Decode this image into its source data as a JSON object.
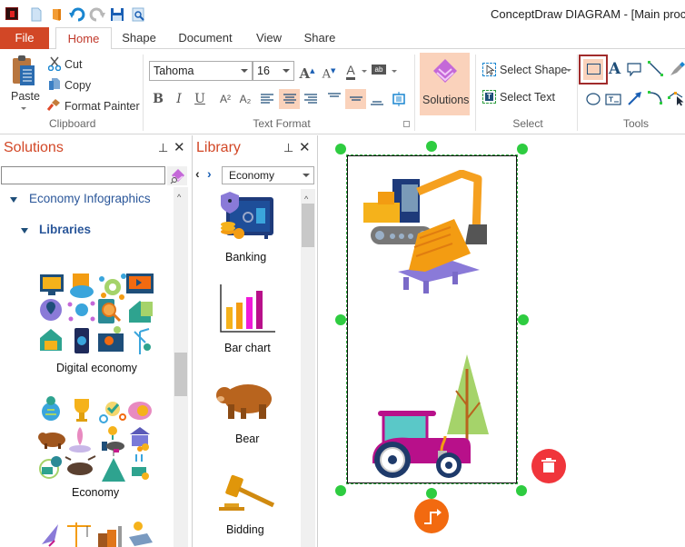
{
  "window": {
    "title": "ConceptDraw DIAGRAM - [Main process"
  },
  "quick_access": [
    {
      "icon": "app-logo-icon"
    },
    {
      "icon": "new-document-icon"
    },
    {
      "icon": "open-folder-icon"
    },
    {
      "icon": "undo-icon"
    },
    {
      "icon": "redo-icon"
    },
    {
      "icon": "save-icon"
    },
    {
      "icon": "print-preview-icon"
    }
  ],
  "tabs": {
    "file": "File",
    "items": [
      {
        "label": "Home",
        "active": true
      },
      {
        "label": "Shape",
        "active": false
      },
      {
        "label": "Document",
        "active": false
      },
      {
        "label": "View",
        "active": false
      },
      {
        "label": "Share",
        "active": false
      }
    ]
  },
  "ribbon": {
    "clipboard": {
      "label": "Clipboard",
      "paste": "Paste",
      "cut": "Cut",
      "copy": "Copy",
      "format_painter": "Format Painter"
    },
    "text_format": {
      "label": "Text Format",
      "font": "Tahoma",
      "size": "16",
      "bold": "B",
      "italic": "I",
      "underline": "U",
      "superscript": "A²",
      "subscript": "A₂",
      "align_active": "center",
      "valign_active": "middle"
    },
    "solutions": {
      "label": "Solutions"
    },
    "select": {
      "label": "Select",
      "select_shape": "Select Shape",
      "select_text": "Select Text"
    },
    "tools": {
      "label": "Tools",
      "active_tool": "rectangle"
    }
  },
  "solutions_panel": {
    "title": "Solutions",
    "search_value": "",
    "tree": [
      {
        "label": "Economy Infographics",
        "expanded": true,
        "level": 0
      },
      {
        "label": "Libraries",
        "expanded": true,
        "level": 1
      }
    ],
    "libraries": [
      {
        "name": "Digital economy"
      },
      {
        "name": "Economy"
      },
      {
        "name": ""
      }
    ]
  },
  "library_panel": {
    "title": "Library",
    "selected_library": "Economy",
    "items": [
      {
        "name": "Banking"
      },
      {
        "name": "Bar chart"
      },
      {
        "name": "Bear"
      },
      {
        "name": "Bidding"
      }
    ]
  },
  "canvas": {
    "shape_contents": [
      "excavator with lumber pallet",
      "tractor with tree"
    ],
    "delete_button_color": "#f0353b",
    "connector_button_color": "#f26a10",
    "handle_color": "#2ecc40"
  },
  "colors": {
    "accent": "#d24726",
    "highlight": "#fad2bb",
    "link_blue": "#2b579a"
  }
}
